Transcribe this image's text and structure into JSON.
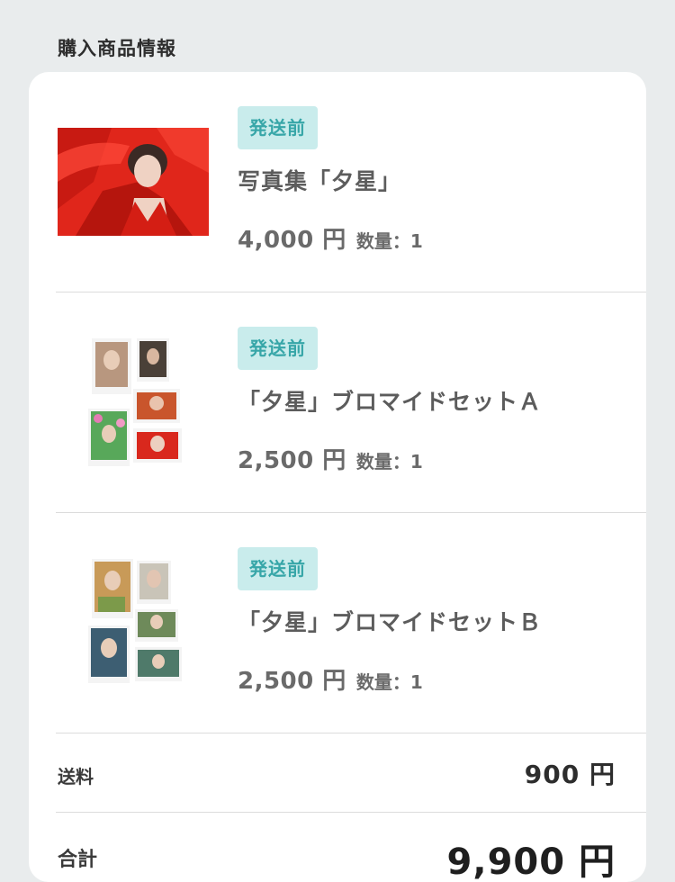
{
  "section_title": "購入商品情報",
  "items": [
    {
      "status": "発送前",
      "name": "写真集「夕星」",
      "price": "4,000 円",
      "quantity": "数量：1",
      "thumbnail": "photobook-cover"
    },
    {
      "status": "発送前",
      "name": "「夕星」ブロマイドセットＡ",
      "price": "2,500 円",
      "quantity": "数量：1",
      "thumbnail": "bromide-set-a"
    },
    {
      "status": "発送前",
      "name": "「夕星」ブロマイドセットＢ",
      "price": "2,500 円",
      "quantity": "数量：1",
      "thumbnail": "bromide-set-b"
    }
  ],
  "summary": {
    "shipping_label": "送料",
    "shipping_value": "900 円",
    "total_label": "合計",
    "total_value": "9,900 円"
  },
  "colors": {
    "page_background": "#e9eced",
    "card_background": "#ffffff",
    "badge_background": "#c9ecec",
    "badge_text": "#37a6a8",
    "divider": "#dcdcdc"
  }
}
